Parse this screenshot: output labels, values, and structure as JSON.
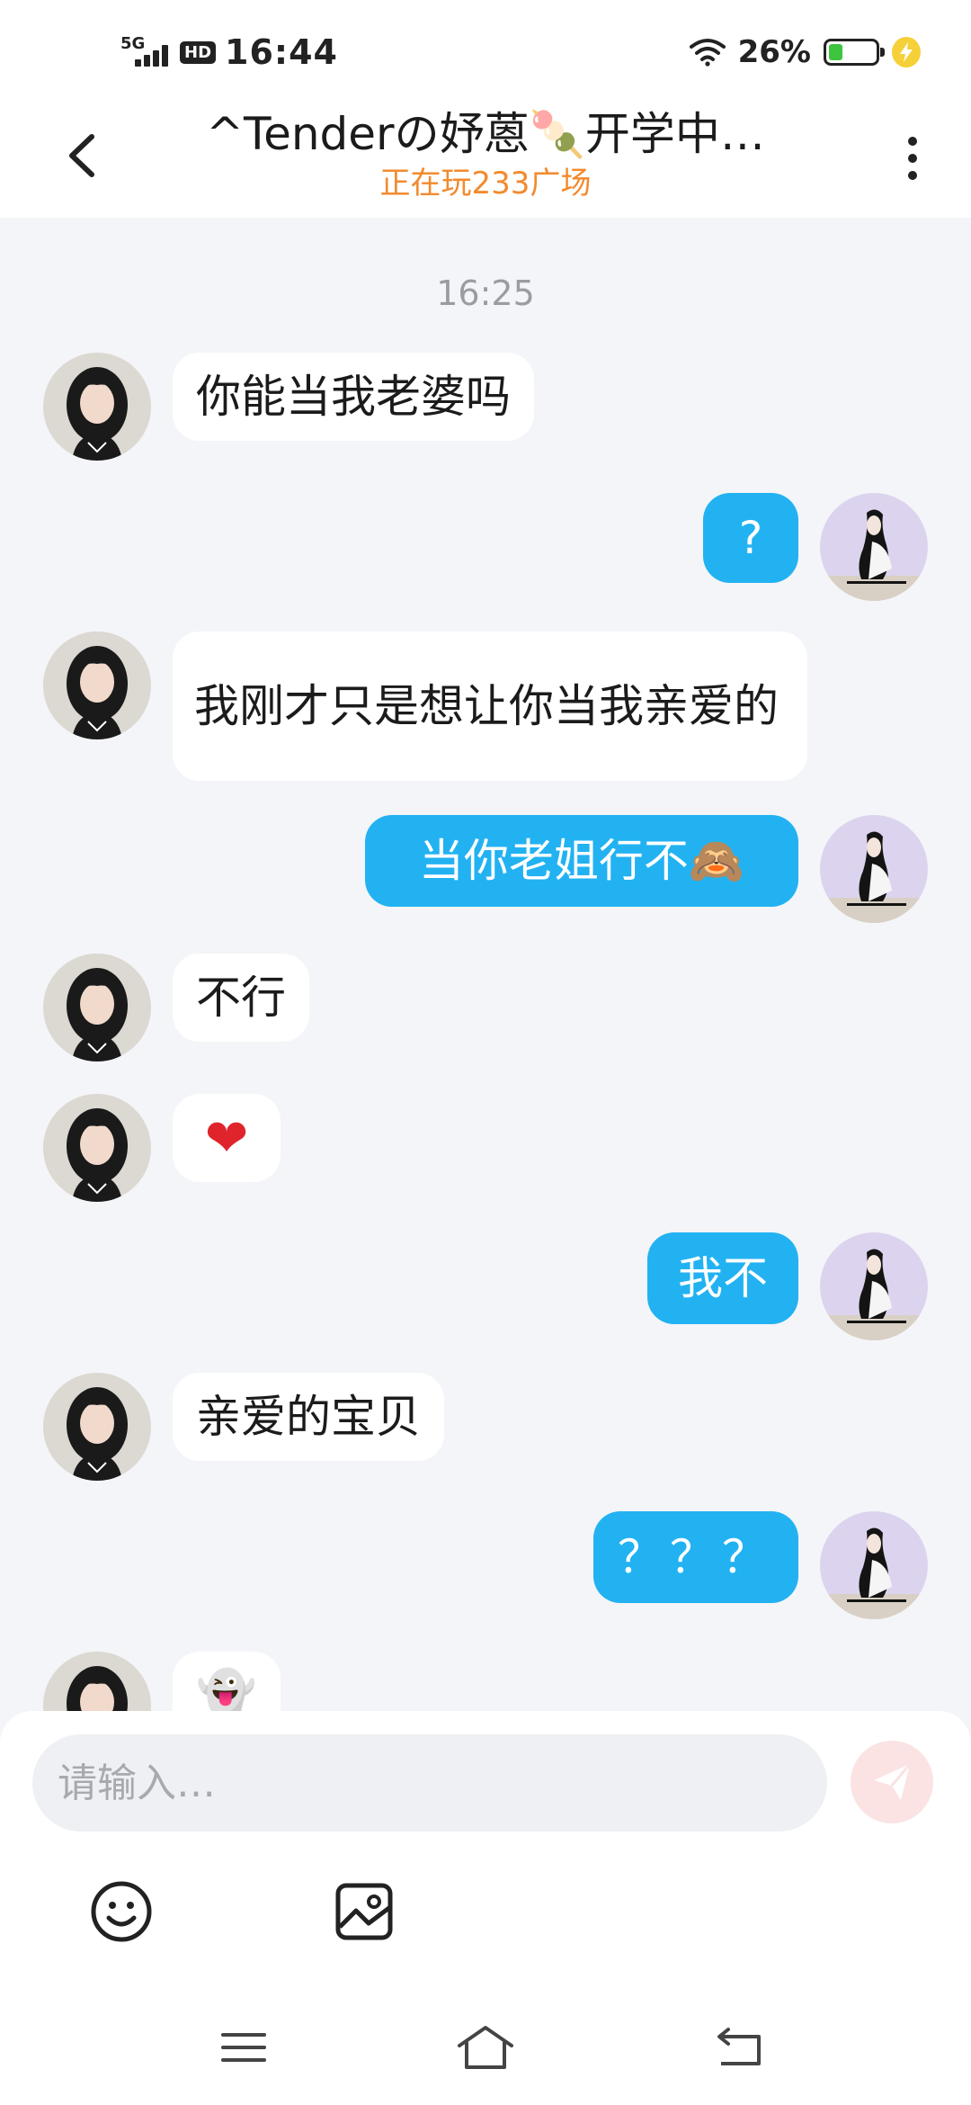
{
  "status_bar": {
    "network": "5G",
    "hd": "HD",
    "time": "16:44",
    "battery": "26%",
    "battery_level": 0.26
  },
  "header": {
    "title": "^Tenderの妤蒽🍡开学中…",
    "subtitle": "正在玩233广场"
  },
  "chat": {
    "timestamp": "16:25",
    "messages": [
      {
        "side": "in",
        "text": "你能当我老婆吗"
      },
      {
        "side": "out",
        "text": "?"
      },
      {
        "side": "in",
        "text": "我刚才只是想让你当我亲爱的"
      },
      {
        "side": "out",
        "text": "当你老姐行不🙈"
      },
      {
        "side": "in",
        "text": "不行"
      },
      {
        "side": "in",
        "text": "❤"
      },
      {
        "side": "out",
        "text": "我不"
      },
      {
        "side": "in",
        "text": "亲爱的宝贝"
      },
      {
        "side": "out",
        "text": "？？？"
      },
      {
        "side": "in",
        "text": "👻"
      }
    ]
  },
  "input": {
    "placeholder": "请输入…"
  },
  "icons": {
    "back": "back-arrow-icon",
    "more": "more-vertical-icon",
    "send": "send-icon",
    "emoji": "emoji-icon",
    "image": "image-icon",
    "menu": "menu-icon",
    "home": "home-icon",
    "return": "return-icon"
  },
  "colors": {
    "accent": "#22b2f2",
    "subtitle": "#f28a2e",
    "background": "#f4f5f8"
  }
}
